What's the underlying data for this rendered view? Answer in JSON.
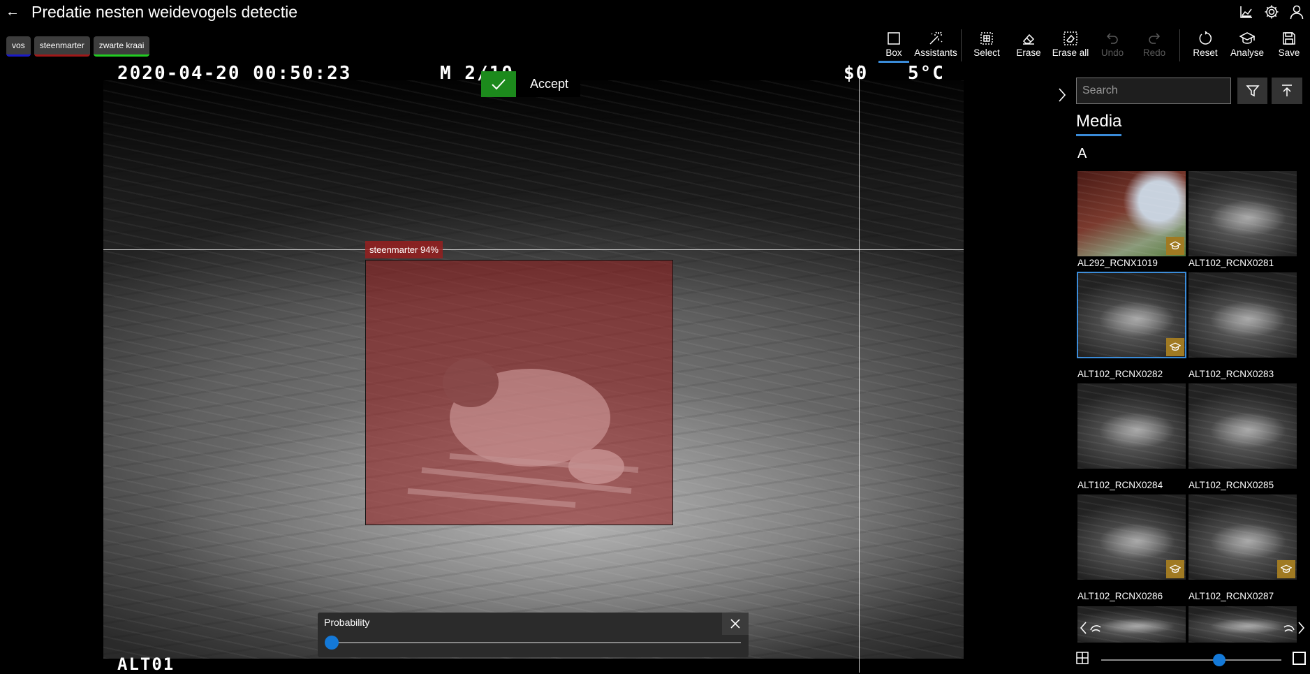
{
  "window": {
    "title": "Predatie nesten weidevogels detectie",
    "icons": [
      "chart-icon",
      "settings-icon",
      "user-icon"
    ]
  },
  "labels": [
    {
      "name": "vos",
      "color": "#1a1ac8"
    },
    {
      "name": "steenmarter",
      "color": "#a01818"
    },
    {
      "name": "zwarte kraai",
      "color": "#22cc22"
    }
  ],
  "toolbar": {
    "box": "Box",
    "assistants": "Assistants",
    "select": "Select",
    "erase": "Erase",
    "erase_all": "Erase all",
    "undo": "Undo",
    "redo": "Redo",
    "reset": "Reset",
    "analyse": "Analyse",
    "save": "Save"
  },
  "image": {
    "timestamp": "2020-04-20 00:50:23",
    "mode": "M 2/10",
    "temperature": "5°C",
    "moon": "$0",
    "site": "ALT01"
  },
  "detection": {
    "label": "steenmarter 94%",
    "accept": "Accept"
  },
  "probability": {
    "title": "Probability",
    "value": 0
  },
  "panel": {
    "search_placeholder": "Search",
    "media_title": "Media",
    "group": "A",
    "items": [
      {
        "name": "AL292_RCNX1019",
        "badge": true,
        "selected": false
      },
      {
        "name": "ALT102_RCNX0281",
        "badge": false,
        "selected": false
      },
      {
        "name": "ALT102_RCNX0282",
        "badge": true,
        "selected": true
      },
      {
        "name": "ALT102_RCNX0283",
        "badge": false,
        "selected": false
      },
      {
        "name": "ALT102_RCNX0284",
        "badge": false,
        "selected": false
      },
      {
        "name": "ALT102_RCNX0285",
        "badge": false,
        "selected": false
      },
      {
        "name": "ALT102_RCNX0286",
        "badge": true,
        "selected": false
      },
      {
        "name": "ALT102_RCNX0287",
        "badge": true,
        "selected": false
      }
    ]
  },
  "colors": {
    "accent": "#1479d8",
    "accept": "#1c8a1c",
    "box_fill": "#961e1e",
    "badge": "#a07a22"
  }
}
